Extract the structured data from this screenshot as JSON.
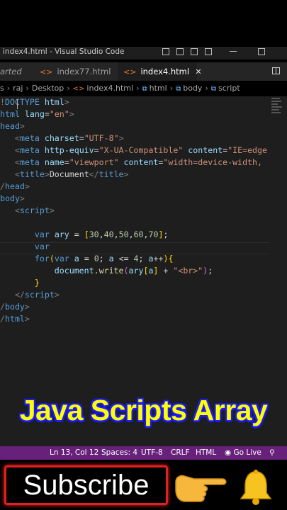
{
  "window": {
    "title": "index4.html - Visual Studio Code"
  },
  "tabs": [
    {
      "label": "arted",
      "active": false
    },
    {
      "label": "index77.html",
      "active": false
    },
    {
      "label": "index4.html",
      "active": true,
      "close": "✕"
    }
  ],
  "breadcrumb": [
    "s",
    "raj",
    "Desktop",
    "index4.html",
    "html",
    "body",
    "script"
  ],
  "code_lines": [
    [
      [
        "t-br",
        "!"
      ],
      [
        "t-tag",
        "DOCTYPE"
      ],
      [
        "t-txt",
        " "
      ],
      [
        "t-attr",
        "html"
      ],
      [
        "t-br",
        ">"
      ]
    ],
    [
      [
        "t-tag",
        "html"
      ],
      [
        "t-txt",
        " "
      ],
      [
        "t-attr",
        "lang"
      ],
      [
        "t-txt",
        "="
      ],
      [
        "t-str",
        "\"en\""
      ],
      [
        "t-br",
        ">"
      ]
    ],
    [
      [
        "t-tag",
        "head"
      ],
      [
        "t-br",
        ">"
      ]
    ],
    [
      [
        "t-txt",
        "   "
      ],
      [
        "t-br",
        "<"
      ],
      [
        "t-tag",
        "meta"
      ],
      [
        "t-txt",
        " "
      ],
      [
        "t-attr",
        "charset"
      ],
      [
        "t-txt",
        "="
      ],
      [
        "t-str",
        "\"UTF-8\""
      ],
      [
        "t-br",
        ">"
      ]
    ],
    [
      [
        "t-txt",
        "   "
      ],
      [
        "t-br",
        "<"
      ],
      [
        "t-tag",
        "meta"
      ],
      [
        "t-txt",
        " "
      ],
      [
        "t-attr",
        "http-equiv"
      ],
      [
        "t-txt",
        "="
      ],
      [
        "t-str",
        "\"X-UA-Compatible\""
      ],
      [
        "t-txt",
        " "
      ],
      [
        "t-attr",
        "content"
      ],
      [
        "t-txt",
        "="
      ],
      [
        "t-str",
        "\"IE=edge"
      ]
    ],
    [
      [
        "t-txt",
        "   "
      ],
      [
        "t-br",
        "<"
      ],
      [
        "t-tag",
        "meta"
      ],
      [
        "t-txt",
        " "
      ],
      [
        "t-attr",
        "name"
      ],
      [
        "t-txt",
        "="
      ],
      [
        "t-str",
        "\"viewport\""
      ],
      [
        "t-txt",
        " "
      ],
      [
        "t-attr",
        "content"
      ],
      [
        "t-txt",
        "="
      ],
      [
        "t-str",
        "\"width=device-width,"
      ]
    ],
    [
      [
        "t-txt",
        "   "
      ],
      [
        "t-br",
        "<"
      ],
      [
        "t-tag",
        "title"
      ],
      [
        "t-br",
        ">"
      ],
      [
        "t-txt",
        "Document"
      ],
      [
        "t-br",
        "</"
      ],
      [
        "t-tag",
        "title"
      ],
      [
        "t-br",
        ">"
      ]
    ],
    [
      [
        "t-br",
        "/"
      ],
      [
        "t-tag",
        "head"
      ],
      [
        "t-br",
        ">"
      ]
    ],
    [
      [
        "t-tag",
        "body"
      ],
      [
        "t-br",
        ">"
      ]
    ],
    [
      [
        "t-txt",
        "   "
      ],
      [
        "t-br",
        "<"
      ],
      [
        "t-tag",
        "script"
      ],
      [
        "t-br",
        ">"
      ]
    ],
    [
      [
        "t-txt",
        ""
      ]
    ],
    [
      [
        "t-txt",
        "       "
      ],
      [
        "t-kw",
        "var"
      ],
      [
        "t-txt",
        " "
      ],
      [
        "t-var",
        "ary"
      ],
      [
        "t-txt",
        " = "
      ],
      [
        "t-br2",
        "["
      ],
      [
        "t-num",
        "30"
      ],
      [
        "t-txt",
        ","
      ],
      [
        "t-num",
        "40"
      ],
      [
        "t-txt",
        ","
      ],
      [
        "t-num",
        "50"
      ],
      [
        "t-txt",
        ","
      ],
      [
        "t-num",
        "60"
      ],
      [
        "t-txt",
        ","
      ],
      [
        "t-num",
        "70"
      ],
      [
        "t-br2",
        "]"
      ],
      [
        "t-txt",
        ";"
      ]
    ],
    [
      [
        "t-txt",
        "       "
      ],
      [
        "t-kw",
        "var"
      ]
    ],
    [
      [
        "t-txt",
        "       "
      ],
      [
        "t-kw",
        "for"
      ],
      [
        "t-br2",
        "("
      ],
      [
        "t-kw",
        "var"
      ],
      [
        "t-txt",
        " "
      ],
      [
        "t-var",
        "a"
      ],
      [
        "t-txt",
        " = "
      ],
      [
        "t-num",
        "0"
      ],
      [
        "t-txt",
        "; "
      ],
      [
        "t-var",
        "a"
      ],
      [
        "t-txt",
        " <= "
      ],
      [
        "t-num",
        "4"
      ],
      [
        "t-txt",
        "; "
      ],
      [
        "t-var",
        "a"
      ],
      [
        "t-txt",
        "++"
      ],
      [
        "t-br2",
        ")"
      ],
      [
        "t-br2",
        "{"
      ]
    ],
    [
      [
        "t-txt",
        "           "
      ],
      [
        "t-var",
        "document"
      ],
      [
        "t-txt",
        "."
      ],
      [
        "t-fn",
        "write"
      ],
      [
        "t-br3",
        "("
      ],
      [
        "t-var",
        "ary"
      ],
      [
        "t-br2",
        "["
      ],
      [
        "t-var",
        "a"
      ],
      [
        "t-br2",
        "]"
      ],
      [
        "t-txt",
        " + "
      ],
      [
        "t-str",
        "\"<br>\""
      ],
      [
        "t-br3",
        ")"
      ],
      [
        "t-txt",
        ";"
      ]
    ],
    [
      [
        "t-txt",
        "       "
      ],
      [
        "t-br2",
        "}"
      ]
    ],
    [
      [
        "t-txt",
        "   "
      ],
      [
        "t-br",
        "</"
      ],
      [
        "t-tag",
        "script"
      ],
      [
        "t-br",
        ">"
      ]
    ],
    [
      [
        "t-br",
        "/"
      ],
      [
        "t-tag",
        "body"
      ],
      [
        "t-br",
        ">"
      ]
    ],
    [
      [
        "t-br",
        "/"
      ],
      [
        "t-tag",
        "html"
      ],
      [
        "t-br",
        ">"
      ]
    ]
  ],
  "banner": {
    "text": "Java Scripts Array"
  },
  "status": {
    "position": "Ln 13, Col 12",
    "spaces": "Spaces: 4",
    "encoding": "UTF-8",
    "eol": "CRLF",
    "language": "HTML",
    "golive": "◉ Go Live"
  },
  "subscribe": {
    "label": "Subscribe"
  },
  "colors": {
    "accent": "#68217a",
    "banner": "#ffff00",
    "subscribe_border": "#e41f1f"
  }
}
